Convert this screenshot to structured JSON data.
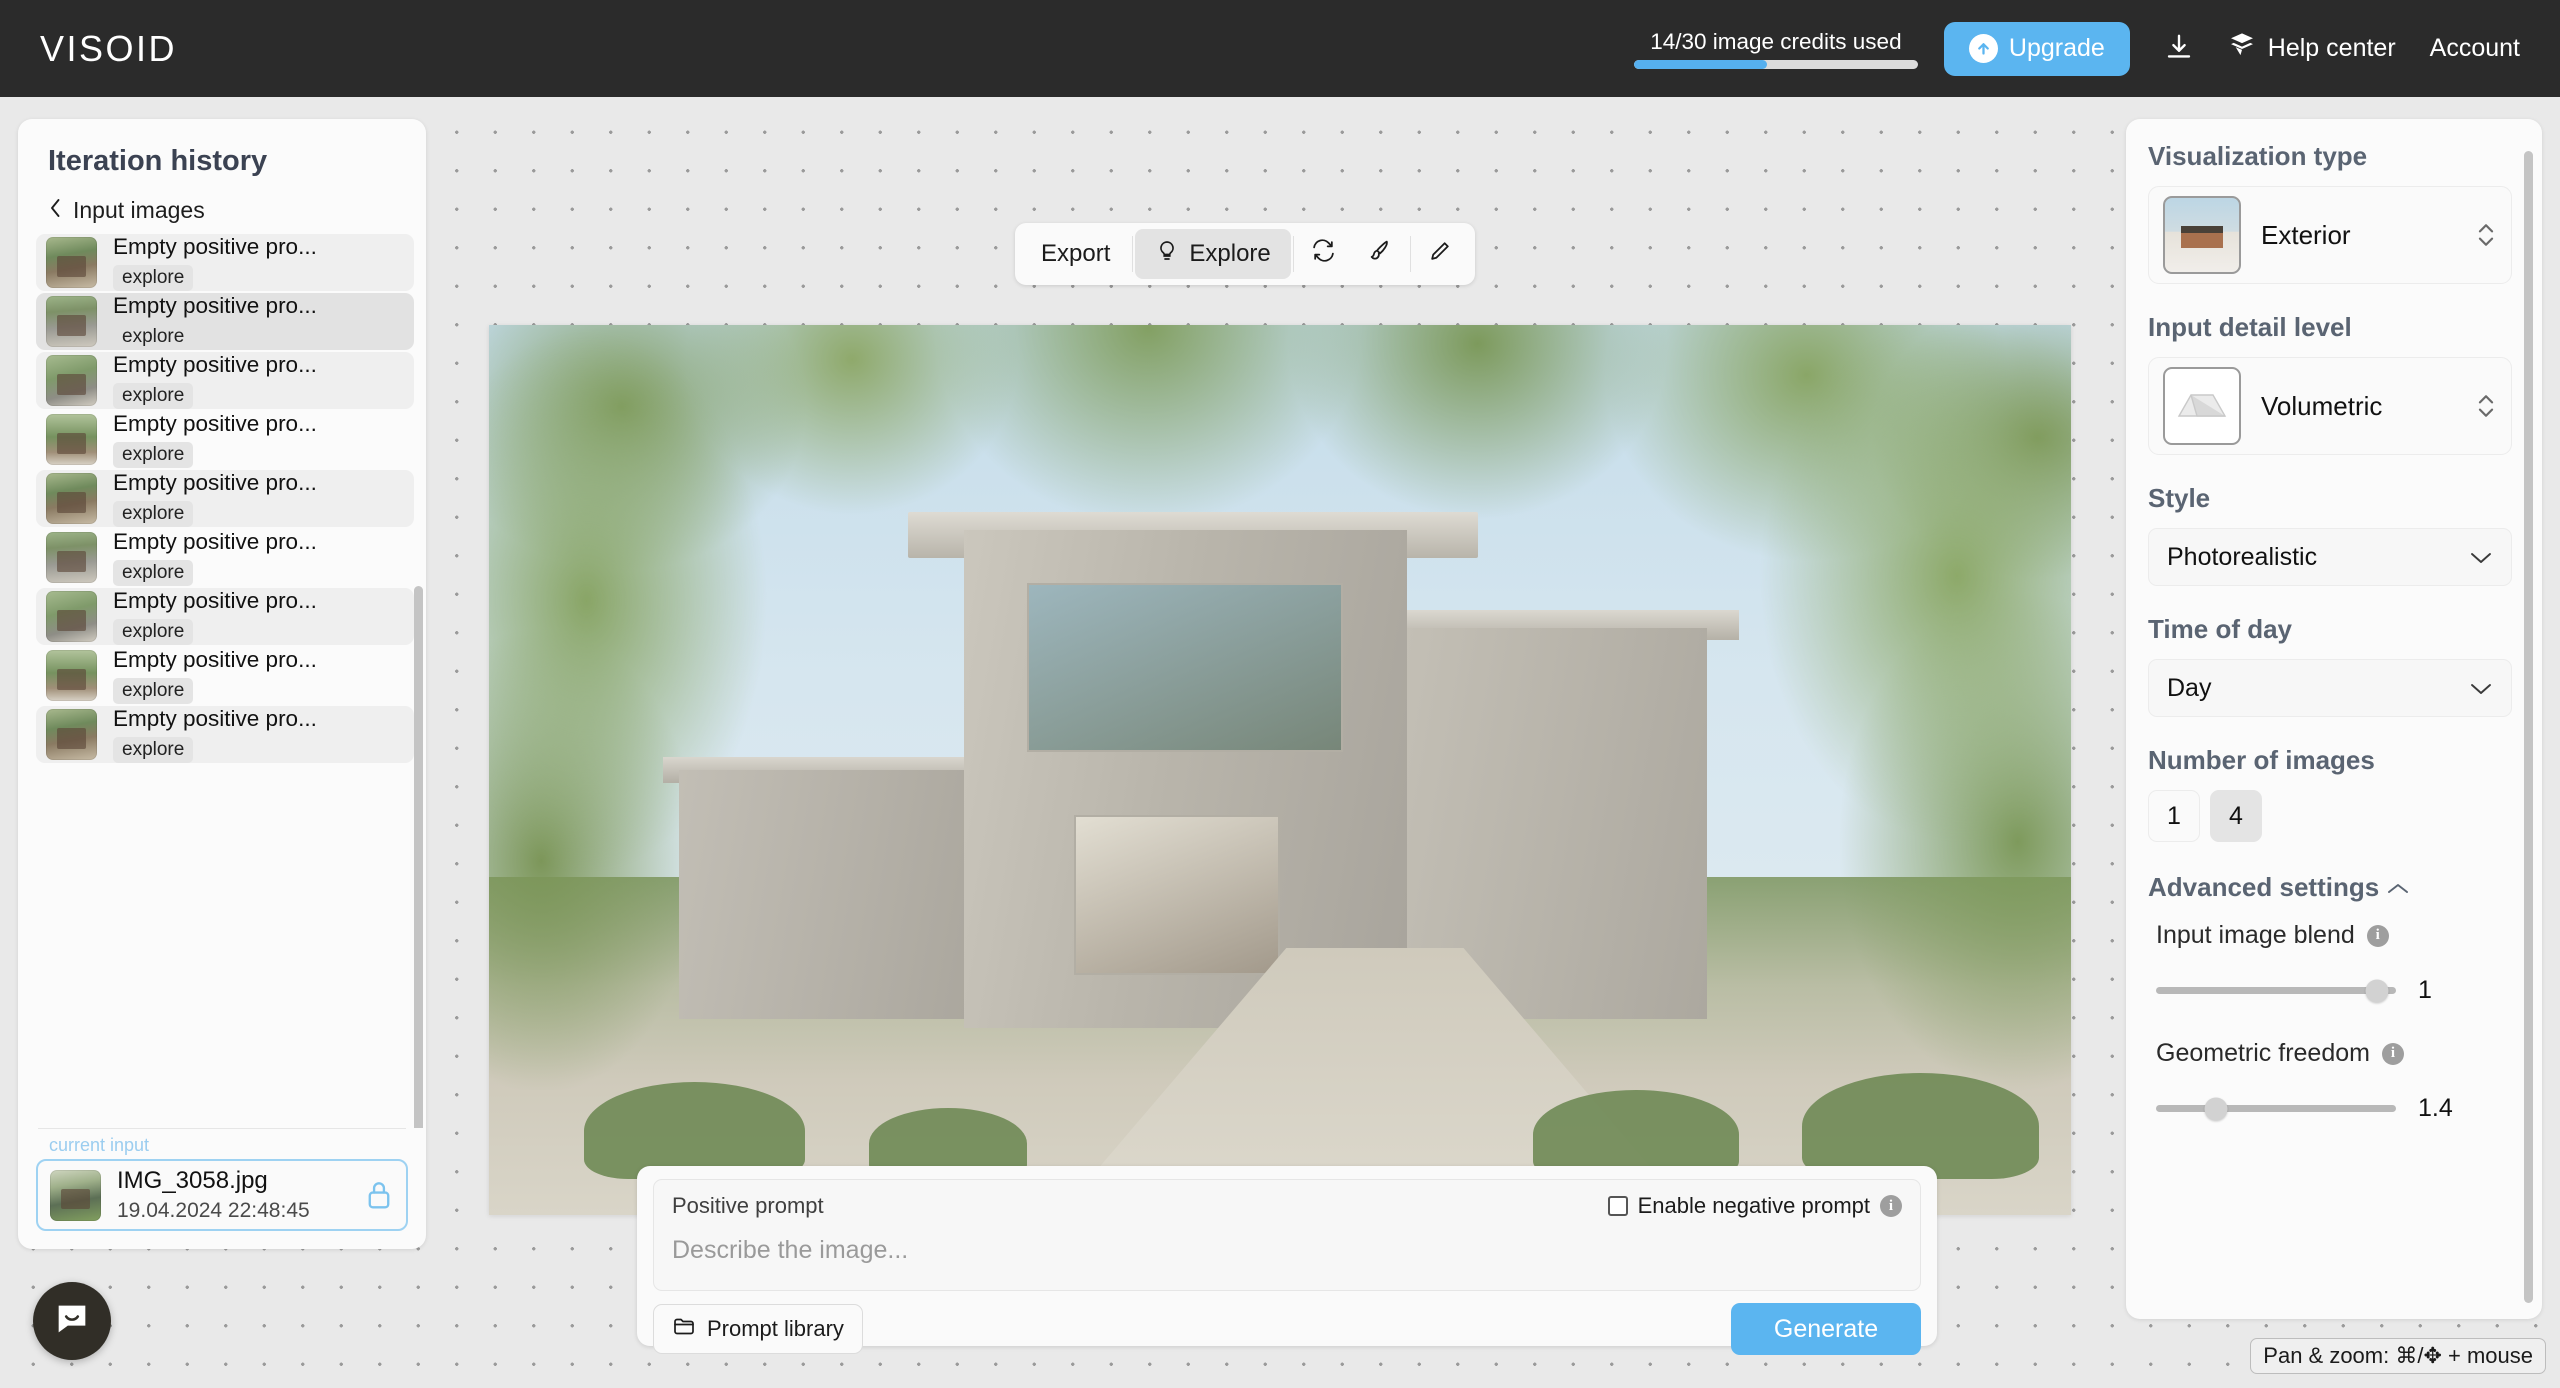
{
  "header": {
    "brand": "VISOID",
    "credits_text": "14/30 image credits used",
    "credits_used": 14,
    "credits_total": 30,
    "credits_percent": 47,
    "upgrade_label": "Upgrade",
    "download_icon": "download-icon",
    "help_label": "Help center",
    "account_label": "Account",
    "accent_color": "#5bb5f0",
    "bg_color": "#2b2b2b"
  },
  "sidebar": {
    "title": "Iteration history",
    "back_label": "Input images",
    "items": [
      {
        "title": "Empty positive pro...",
        "tag": "explore"
      },
      {
        "title": "Empty positive pro...",
        "tag": "explore"
      },
      {
        "title": "Empty positive pro...",
        "tag": "explore"
      },
      {
        "title": "Empty positive pro...",
        "tag": "explore"
      },
      {
        "title": "Empty positive pro...",
        "tag": "explore"
      },
      {
        "title": "Empty positive pro...",
        "tag": "explore"
      },
      {
        "title": "Empty positive pro...",
        "tag": "explore"
      },
      {
        "title": "Empty positive pro...",
        "tag": "explore"
      },
      {
        "title": "Empty positive pro...",
        "tag": "explore"
      }
    ],
    "current": {
      "label": "current input",
      "filename": "IMG_3058.jpg",
      "timestamp": "19.04.2024 22:48:45",
      "lock_icon": "lock-icon"
    }
  },
  "toolbar": {
    "export_label": "Export",
    "explore_label": "Explore",
    "explore_icon": "lightbulb-icon",
    "refresh_icon": "refresh-icon",
    "brush_icon": "brush-icon",
    "pencil_icon": "pencil-icon"
  },
  "prompt": {
    "positive_label": "Positive prompt",
    "negative_label": "Enable negative prompt",
    "negative_checked": false,
    "placeholder": "Describe the image...",
    "value": "",
    "library_label": "Prompt library",
    "library_icon": "folder-icon",
    "generate_label": "Generate"
  },
  "settings": {
    "visualization_type": {
      "label": "Visualization type",
      "value": "Exterior"
    },
    "input_detail_level": {
      "label": "Input detail level",
      "value": "Volumetric"
    },
    "style": {
      "label": "Style",
      "value": "Photorealistic"
    },
    "time_of_day": {
      "label": "Time of day",
      "value": "Day"
    },
    "number_of_images": {
      "label": "Number of images",
      "options": [
        "1",
        "4"
      ],
      "selected": "4"
    },
    "advanced": {
      "label": "Advanced settings",
      "expanded": true,
      "input_image_blend": {
        "label": "Input image blend",
        "value": "1",
        "percent": 92
      },
      "geometric_freedom": {
        "label": "Geometric freedom",
        "value": "1.4",
        "percent": 25
      }
    }
  },
  "canvas": {
    "panzoom_hint": "Pan & zoom: ⌘/✥ + mouse"
  },
  "support": {
    "chat_icon": "chat-bubble-icon"
  }
}
